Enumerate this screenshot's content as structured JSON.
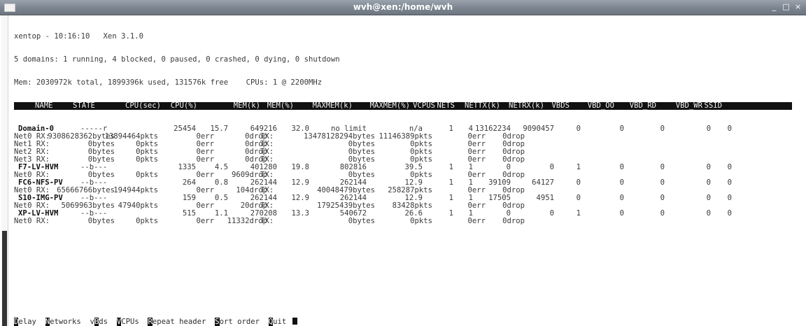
{
  "window": {
    "title": "wvh@xen:/home/wvh",
    "minimize": "_",
    "maximize": "□",
    "close": "×"
  },
  "summary": {
    "line1": "xentop - 10:16:10   Xen 3.1.0",
    "line2": "5 domains: 1 running, 4 blocked, 0 paused, 0 crashed, 0 dying, 0 shutdown",
    "line3": "Mem: 2030972k total, 1899396k used, 131576k free    CPUs: 1 @ 2200MHz"
  },
  "columns": [
    {
      "key": "name",
      "label": "NAME"
    },
    {
      "key": "state",
      "label": "STATE"
    },
    {
      "key": "cpu_sec",
      "label": "CPU(sec)"
    },
    {
      "key": "cpu_pct",
      "label": "CPU(%)"
    },
    {
      "key": "mem_k",
      "label": "MEM(k)"
    },
    {
      "key": "mem_pct",
      "label": "MEM(%)"
    },
    {
      "key": "maxmem_k",
      "label": "MAXMEM(k)"
    },
    {
      "key": "maxmem_pct",
      "label": "MAXMEM(%)"
    },
    {
      "key": "vcpus",
      "label": "VCPUS"
    },
    {
      "key": "nets",
      "label": "NETS"
    },
    {
      "key": "nettx",
      "label": "NETTX(k)"
    },
    {
      "key": "netrx",
      "label": "NETRX(k)"
    },
    {
      "key": "vbds",
      "label": "VBDS"
    },
    {
      "key": "vbd_oo",
      "label": "VBD_OO"
    },
    {
      "key": "vbd_rd",
      "label": "VBD_RD"
    },
    {
      "key": "vbd_wr",
      "label": "VBD_WR"
    },
    {
      "key": "ssid",
      "label": "SSID"
    }
  ],
  "domains": [
    {
      "name": "Domain-0",
      "state": "-----r",
      "cpu_sec": "25454",
      "cpu_pct": "15.7",
      "mem_k": "649216",
      "mem_pct": "32.0",
      "maxmem_k": "no limit",
      "maxmem_pct": "n/a",
      "vcpus": "1",
      "nets": "4",
      "nettx": "13162234",
      "netrx": "9090457",
      "vbds": "0",
      "vbd_oo": "0",
      "vbd_rd": "0",
      "vbd_wr": "0",
      "ssid": "0",
      "net_lines": [
        {
          "label": "Net0 RX:",
          "rx_bytes": "9308628362bytes",
          "rx_pkts": "13894464pkts",
          "rx_err": "0err",
          "rx_drop": "0drop",
          "tx_label": "TX:",
          "tx_bytes": "13478128294bytes",
          "tx_pkts": "11146389pkts",
          "tx_err": "0err",
          "tx_drop": "0drop"
        },
        {
          "label": "Net1 RX:",
          "rx_bytes": "0bytes",
          "rx_pkts": "0pkts",
          "rx_err": "0err",
          "rx_drop": "0drop",
          "tx_label": "TX:",
          "tx_bytes": "0bytes",
          "tx_pkts": "0pkts",
          "tx_err": "0err",
          "tx_drop": "0drop"
        },
        {
          "label": "Net2 RX:",
          "rx_bytes": "0bytes",
          "rx_pkts": "0pkts",
          "rx_err": "0err",
          "rx_drop": "0drop",
          "tx_label": "TX:",
          "tx_bytes": "0bytes",
          "tx_pkts": "0pkts",
          "tx_err": "0err",
          "tx_drop": "0drop"
        },
        {
          "label": "Net3 RX:",
          "rx_bytes": "0bytes",
          "rx_pkts": "0pkts",
          "rx_err": "0err",
          "rx_drop": "0drop",
          "tx_label": "TX:",
          "tx_bytes": "0bytes",
          "tx_pkts": "0pkts",
          "tx_err": "0err",
          "tx_drop": "0drop"
        }
      ]
    },
    {
      "name": "F7-LV-HVM",
      "state": "--b---",
      "cpu_sec": "1335",
      "cpu_pct": "4.5",
      "mem_k": "401280",
      "mem_pct": "19.8",
      "maxmem_k": "802816",
      "maxmem_pct": "39.5",
      "vcpus": "1",
      "nets": "1",
      "nettx": "0",
      "netrx": "0",
      "vbds": "1",
      "vbd_oo": "0",
      "vbd_rd": "0",
      "vbd_wr": "0",
      "ssid": "0",
      "net_lines": [
        {
          "label": "Net0 RX:",
          "rx_bytes": "0bytes",
          "rx_pkts": "0pkts",
          "rx_err": "0err",
          "rx_drop": "9609drop",
          "tx_label": "TX:",
          "tx_bytes": "0bytes",
          "tx_pkts": "0pkts",
          "tx_err": "0err",
          "tx_drop": "0drop"
        }
      ]
    },
    {
      "name": "FC6-NFS-PV",
      "state": "--b---",
      "cpu_sec": "264",
      "cpu_pct": "0.8",
      "mem_k": "262144",
      "mem_pct": "12.9",
      "maxmem_k": "262144",
      "maxmem_pct": "12.9",
      "vcpus": "1",
      "nets": "1",
      "nettx": "39109",
      "netrx": "64127",
      "vbds": "0",
      "vbd_oo": "0",
      "vbd_rd": "0",
      "vbd_wr": "0",
      "ssid": "0",
      "net_lines": [
        {
          "label": "Net0 RX:",
          "rx_bytes": "65666766bytes",
          "rx_pkts": "194944pkts",
          "rx_err": "0err",
          "rx_drop": "104drop",
          "tx_label": "TX:",
          "tx_bytes": "40048479bytes",
          "tx_pkts": "258287pkts",
          "tx_err": "0err",
          "tx_drop": "0drop"
        }
      ]
    },
    {
      "name": "S10-IMG-PV",
      "state": "--b---",
      "cpu_sec": "159",
      "cpu_pct": "0.5",
      "mem_k": "262144",
      "mem_pct": "12.9",
      "maxmem_k": "262144",
      "maxmem_pct": "12.9",
      "vcpus": "1",
      "nets": "1",
      "nettx": "17505",
      "netrx": "4951",
      "vbds": "0",
      "vbd_oo": "0",
      "vbd_rd": "0",
      "vbd_wr": "0",
      "ssid": "0",
      "net_lines": [
        {
          "label": "Net0 RX:",
          "rx_bytes": "5069963bytes",
          "rx_pkts": "47940pkts",
          "rx_err": "0err",
          "rx_drop": "20drop",
          "tx_label": "TX:",
          "tx_bytes": "17925439bytes",
          "tx_pkts": "83428pkts",
          "tx_err": "0err",
          "tx_drop": "0drop"
        }
      ]
    },
    {
      "name": "XP-LV-HVM",
      "state": "--b---",
      "cpu_sec": "515",
      "cpu_pct": "1.1",
      "mem_k": "270208",
      "mem_pct": "13.3",
      "maxmem_k": "540672",
      "maxmem_pct": "26.6",
      "vcpus": "1",
      "nets": "1",
      "nettx": "0",
      "netrx": "0",
      "vbds": "1",
      "vbd_oo": "0",
      "vbd_rd": "0",
      "vbd_wr": "0",
      "ssid": "0",
      "net_lines": [
        {
          "label": "Net0 RX:",
          "rx_bytes": "0bytes",
          "rx_pkts": "0pkts",
          "rx_err": "0err",
          "rx_drop": "11332drop",
          "tx_label": "TX:",
          "tx_bytes": "0bytes",
          "tx_pkts": "0pkts",
          "tx_err": "0err",
          "tx_drop": "0drop"
        }
      ]
    }
  ],
  "menu": [
    {
      "key": "D",
      "rest": "elay",
      "name": "delay"
    },
    {
      "key": "N",
      "rest": "etworks",
      "name": "networks"
    },
    {
      "key": "v",
      "rest": "",
      "name": "vbds",
      "pre": "",
      "mid_key": "B",
      "post": "ds"
    },
    {
      "key": "V",
      "rest": "CPUs",
      "name": "vcpus"
    },
    {
      "key": "R",
      "rest": "epeat header",
      "name": "repeat-header"
    },
    {
      "key": "S",
      "rest": "ort order",
      "name": "sort-order"
    },
    {
      "key": "Q",
      "rest": "uit",
      "name": "quit"
    }
  ],
  "colors": {
    "header_bg": "#111111",
    "text": "#3a3a3a",
    "titlebar": "#7c858f"
  },
  "icons": {
    "menu": "window-menu-icon",
    "scroll": "scrollbar"
  }
}
